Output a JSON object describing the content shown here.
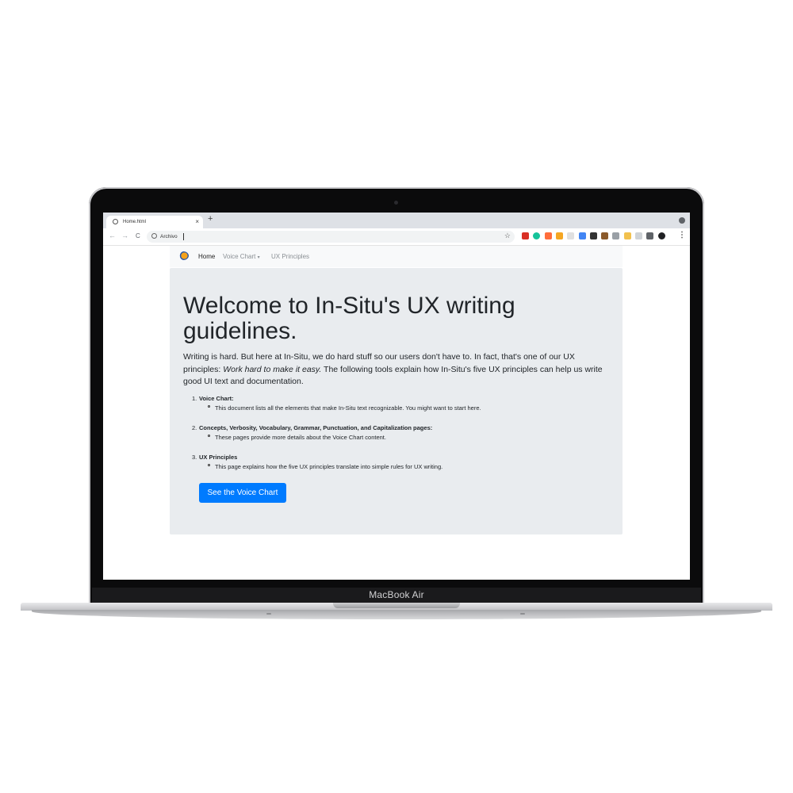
{
  "device": {
    "model_label": "MacBook Air"
  },
  "browser": {
    "tab_title": "Home.html",
    "tab_close": "×",
    "new_tab": "+",
    "url": "Archivo",
    "back": "←",
    "forward": "→",
    "reload": "C",
    "menu": "⋮",
    "star": "☆",
    "extensions": [
      {
        "icon": "extension-red-icon",
        "color": "#d93025"
      },
      {
        "icon": "grammarly-icon",
        "color": "#15c39a"
      },
      {
        "icon": "extension-orange-icon",
        "color": "#ff6d3b"
      },
      {
        "icon": "extension-yellow-icon",
        "color": "#f5a623"
      },
      {
        "icon": "extension-gray-icon",
        "color": "#e0e0e0"
      },
      {
        "icon": "extension-new-icon",
        "color": "#4285f4"
      },
      {
        "icon": "extension-dark-icon",
        "color": "#333333"
      },
      {
        "icon": "extension-brown-icon",
        "color": "#8b5a2b"
      },
      {
        "icon": "camera-icon",
        "color": "#9aa0a6"
      },
      {
        "icon": "pen-icon",
        "color": "#f2c14e"
      },
      {
        "icon": "extension-light-icon",
        "color": "#cfd3d7"
      },
      {
        "icon": "puzzle-icon",
        "color": "#5f6368"
      },
      {
        "icon": "avatar-icon",
        "color": "#202124"
      }
    ]
  },
  "navbar": {
    "items": [
      {
        "label": "Home",
        "active": true
      },
      {
        "label": "Voice Chart",
        "dropdown": true
      },
      {
        "label": "UX Principles"
      }
    ],
    "caret": "▾"
  },
  "hero": {
    "heading": "Welcome to In-Situ's UX writing guidelines.",
    "lead_before": "Writing is hard. But here at In-Situ, we do hard stuff so our users don't have to. In fact, that's one of our UX principles: ",
    "lead_em": "Work hard to make it easy.",
    "lead_after": " The following tools explain how In-Situ's five UX principles can help us write good UI text and documentation.",
    "list": [
      {
        "num": "1.",
        "title": "Voice Chart:",
        "desc": "This document lists all the elements that make In-Situ text recognizable. You might want to start here."
      },
      {
        "num": "2.",
        "title": "Concepts, Verbosity, Vocabulary, Grammar, Punctuation, and Capitalization pages:",
        "desc": "These pages provide more details about the Voice Chart content."
      },
      {
        "num": "3.",
        "title": "UX Principles",
        "desc": "This page explains how the five UX principles translate into simple rules for UX writing."
      }
    ],
    "button": "See the Voice Chart"
  },
  "colors": {
    "primary": "#007bff",
    "jumbotron": "#e9ecef",
    "navbar": "#f8f9fa"
  }
}
